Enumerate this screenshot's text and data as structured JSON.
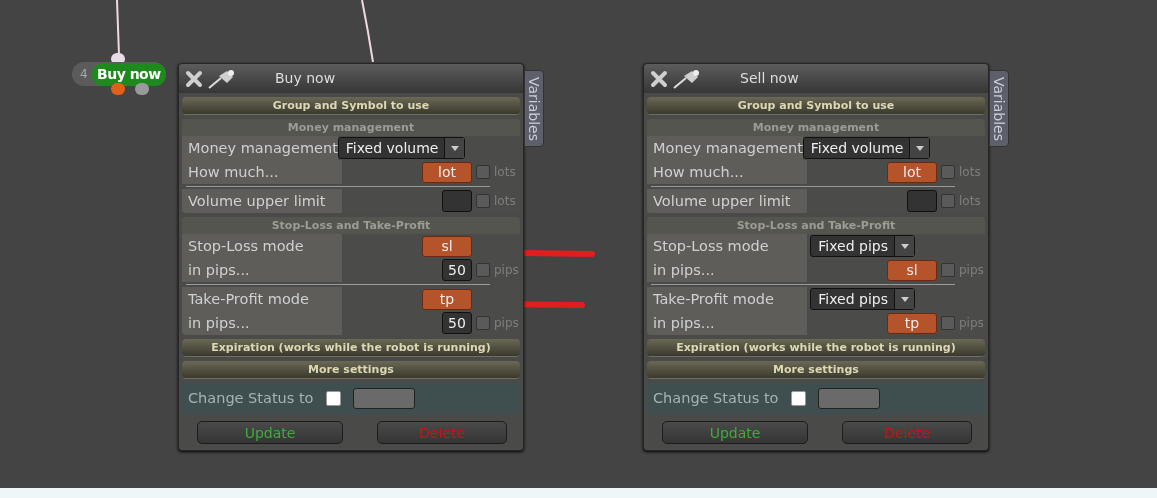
{
  "node": {
    "number": "4",
    "label": "Buy now"
  },
  "panels": [
    {
      "title": "Buy now",
      "side_tab": "Variables",
      "sections": [
        {
          "kind": "header",
          "title": "Group and Symbol to use"
        },
        {
          "kind": "group",
          "title": "Money management",
          "blocks": [
            {
              "rows": [
                {
                  "label": "Money management",
                  "control": {
                    "kind": "select",
                    "value": "Fixed volume"
                  }
                },
                {
                  "label": "How much...",
                  "control": {
                    "kind": "variable",
                    "value": "lot"
                  },
                  "unit": "lots",
                  "unit_checked": false
                }
              ]
            },
            {
              "rows": [
                {
                  "label": "Volume upper limit",
                  "control": {
                    "kind": "number"
                  },
                  "unit": "lots",
                  "unit_checked": false
                }
              ]
            }
          ]
        },
        {
          "kind": "group",
          "title": "Stop-Loss and Take-Profit",
          "blocks": [
            {
              "rows": [
                {
                  "label": "Stop-Loss mode",
                  "control": {
                    "kind": "variable",
                    "value": "sl"
                  }
                },
                {
                  "label": "in pips...",
                  "control": {
                    "kind": "number",
                    "value": "50"
                  },
                  "unit": "pips",
                  "unit_checked": false
                }
              ]
            },
            {
              "rows": [
                {
                  "label": "Take-Profit mode",
                  "control": {
                    "kind": "variable",
                    "value": "tp"
                  }
                },
                {
                  "label": "in pips...",
                  "control": {
                    "kind": "number",
                    "value": "50"
                  },
                  "unit": "pips",
                  "unit_checked": false
                }
              ]
            }
          ]
        },
        {
          "kind": "header",
          "title": "Expiration (works while the robot is running)"
        },
        {
          "kind": "header",
          "title": "More settings"
        }
      ],
      "status": {
        "label": "Change Status to",
        "checked": false
      },
      "buttons": [
        {
          "label": "Update",
          "kind": "update"
        },
        {
          "label": "Delete",
          "kind": "delete"
        }
      ]
    },
    {
      "title": "Sell now",
      "side_tab": "Variables",
      "sections": [
        {
          "kind": "header",
          "title": "Group and Symbol to use"
        },
        {
          "kind": "group",
          "title": "Money management",
          "blocks": [
            {
              "rows": [
                {
                  "label": "Money management",
                  "control": {
                    "kind": "select",
                    "value": "Fixed volume"
                  }
                },
                {
                  "label": "How much...",
                  "control": {
                    "kind": "variable",
                    "value": "lot"
                  },
                  "unit": "lots",
                  "unit_checked": false
                }
              ]
            },
            {
              "rows": [
                {
                  "label": "Volume upper limit",
                  "control": {
                    "kind": "number"
                  },
                  "unit": "lots",
                  "unit_checked": false
                }
              ]
            }
          ]
        },
        {
          "kind": "group",
          "title": "Stop-Loss and Take-Profit",
          "blocks": [
            {
              "rows": [
                {
                  "label": "Stop-Loss mode",
                  "control": {
                    "kind": "select",
                    "value": "Fixed pips"
                  }
                },
                {
                  "label": "in pips...",
                  "control": {
                    "kind": "variable",
                    "value": "sl"
                  },
                  "unit": "pips",
                  "unit_checked": false
                }
              ]
            },
            {
              "rows": [
                {
                  "label": "Take-Profit mode",
                  "control": {
                    "kind": "select",
                    "value": "Fixed pips"
                  }
                },
                {
                  "label": "in pips...",
                  "control": {
                    "kind": "variable",
                    "value": "tp"
                  },
                  "unit": "pips",
                  "unit_checked": false
                }
              ]
            }
          ]
        },
        {
          "kind": "header",
          "title": "Expiration (works while the robot is running)"
        },
        {
          "kind": "header",
          "title": "More settings"
        }
      ],
      "status": {
        "label": "Change Status to",
        "checked": false
      },
      "buttons": [
        {
          "label": "Update",
          "kind": "update"
        },
        {
          "label": "Delete",
          "kind": "delete"
        }
      ]
    }
  ]
}
